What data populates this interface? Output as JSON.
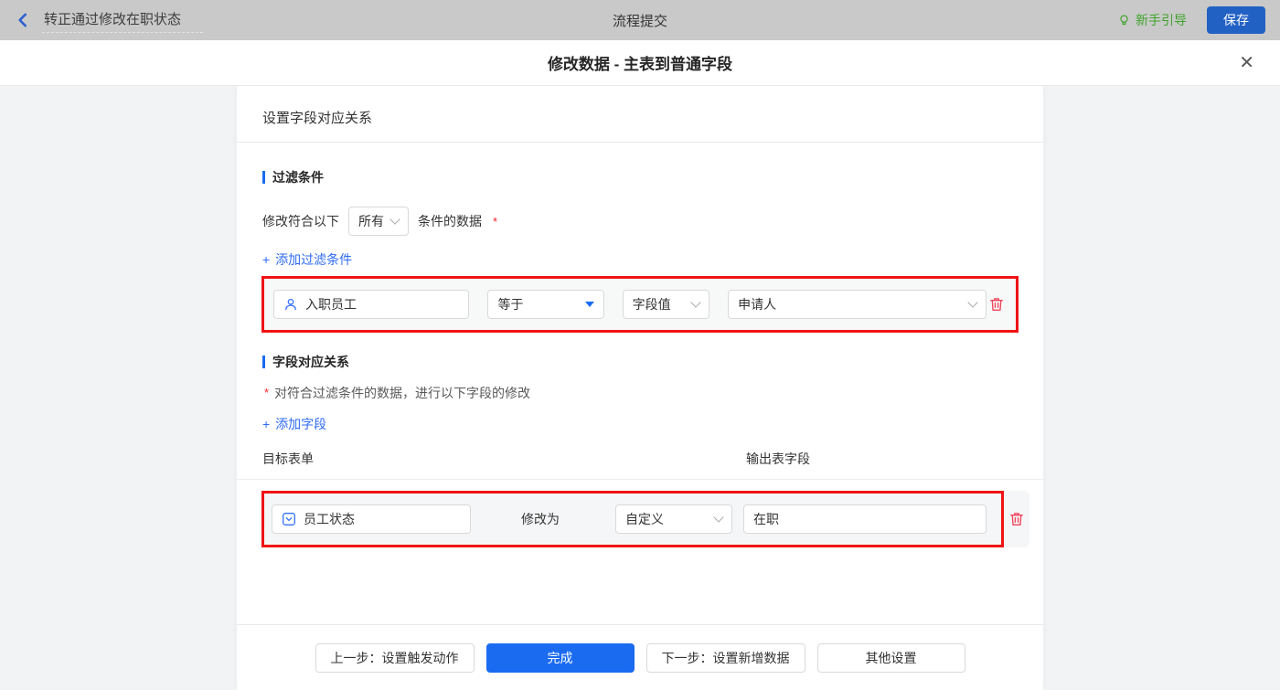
{
  "topbar": {
    "back_title": "转正通过修改在职状态",
    "center_title": "流程提交",
    "guide_label": "新手引导",
    "save_label": "保存"
  },
  "modal": {
    "title": "修改数据 - 主表到普通字段",
    "close_glyph": "✕"
  },
  "panel": {
    "title": "设置字段对应关系",
    "filter_section": {
      "heading": "过滤条件",
      "condition_prefix": "修改符合以下",
      "condition_select_value": "所有",
      "condition_suffix": "条件的数据",
      "required_mark": "*",
      "add_plus": "+",
      "add_label": "添加过滤条件",
      "row": {
        "field": "入职员工",
        "operator": "等于",
        "value_type": "字段值",
        "value": "申请人"
      }
    },
    "mapping_section": {
      "heading": "字段对应关系",
      "required_mark": "*",
      "description": "对符合过滤条件的数据，进行以下字段的修改",
      "add_plus": "+",
      "add_label": "添加字段",
      "col_target": "目标表单",
      "col_output": "输出表字段",
      "row": {
        "field": "员工状态",
        "middle_label": "修改为",
        "value_type": "自定义",
        "value": "在职"
      }
    }
  },
  "footer": {
    "prev_label": "上一步：设置触发动作",
    "done_label": "完成",
    "next_label": "下一步：设置新增数据",
    "other_label": "其他设置"
  },
  "colors": {
    "accent_blue": "#1a6bf0",
    "highlight_red": "#f01414",
    "danger_red": "#f0445a",
    "guide_green": "#3fa32c",
    "topbar_gray": "#c9c9c9"
  }
}
